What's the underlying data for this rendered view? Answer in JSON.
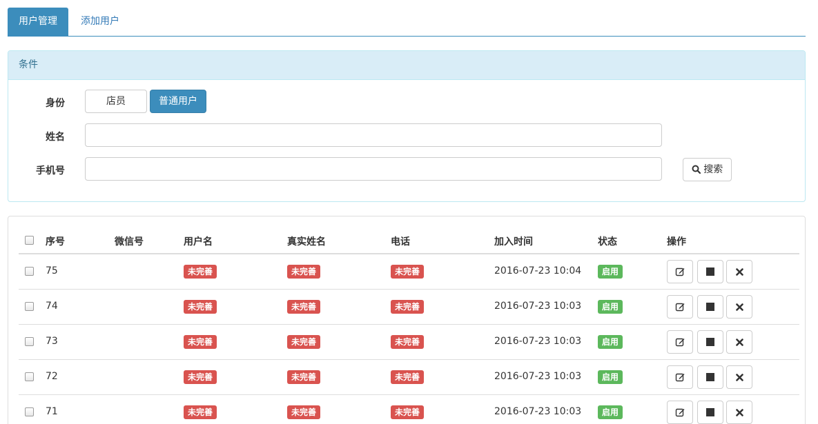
{
  "tabs": [
    {
      "label": "用户管理",
      "active": true
    },
    {
      "label": "添加用户",
      "active": false
    }
  ],
  "filter": {
    "title": "条件",
    "role_label": "身份",
    "role_options": [
      {
        "label": "店员",
        "selected": false
      },
      {
        "label": "普通用户",
        "selected": true
      }
    ],
    "name_label": "姓名",
    "name_value": "",
    "phone_label": "手机号",
    "phone_value": "",
    "search_label": "搜索",
    "search_icon": "search-icon"
  },
  "table": {
    "headers": [
      "序号",
      "微信号",
      "用户名",
      "真实姓名",
      "电话",
      "加入时间",
      "状态",
      "操作"
    ],
    "rows": [
      {
        "id": "75",
        "wechat": "",
        "username": "未完善",
        "realname": "未完善",
        "phone": "未完善",
        "joined": "2016-07-23 10:04",
        "status": "启用"
      },
      {
        "id": "74",
        "wechat": "",
        "username": "未完善",
        "realname": "未完善",
        "phone": "未完善",
        "joined": "2016-07-23 10:03",
        "status": "启用"
      },
      {
        "id": "73",
        "wechat": "",
        "username": "未完善",
        "realname": "未完善",
        "phone": "未完善",
        "joined": "2016-07-23 10:03",
        "status": "启用"
      },
      {
        "id": "72",
        "wechat": "",
        "username": "未完善",
        "realname": "未完善",
        "phone": "未完善",
        "joined": "2016-07-23 10:03",
        "status": "启用"
      },
      {
        "id": "71",
        "wechat": "",
        "username": "未完善",
        "realname": "未完善",
        "phone": "未完善",
        "joined": "2016-07-23 10:03",
        "status": "启用"
      }
    ],
    "action_icons": [
      "edit-icon",
      "stop-icon",
      "delete-icon"
    ]
  },
  "colors": {
    "primary": "#3c8dbc",
    "danger": "#d9534f",
    "success": "#5cb85c",
    "info_bg": "#d9edf7",
    "info_text": "#31708f"
  }
}
